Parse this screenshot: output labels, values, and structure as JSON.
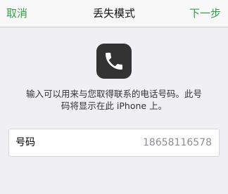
{
  "navbar": {
    "cancel_label": "取消",
    "title": "丢失模式",
    "next_label": "下一步"
  },
  "icon": {
    "name": "phone-icon"
  },
  "description": {
    "line1": "输入可以用来与您取得联系的电话号码。此号",
    "line2": "码将显示在此 iPhone 上。"
  },
  "phone_field": {
    "label": "号码",
    "value": "18658116578"
  },
  "colors": {
    "accent": "#33a043",
    "background": "#efeff4",
    "icon_background": "#333333"
  }
}
